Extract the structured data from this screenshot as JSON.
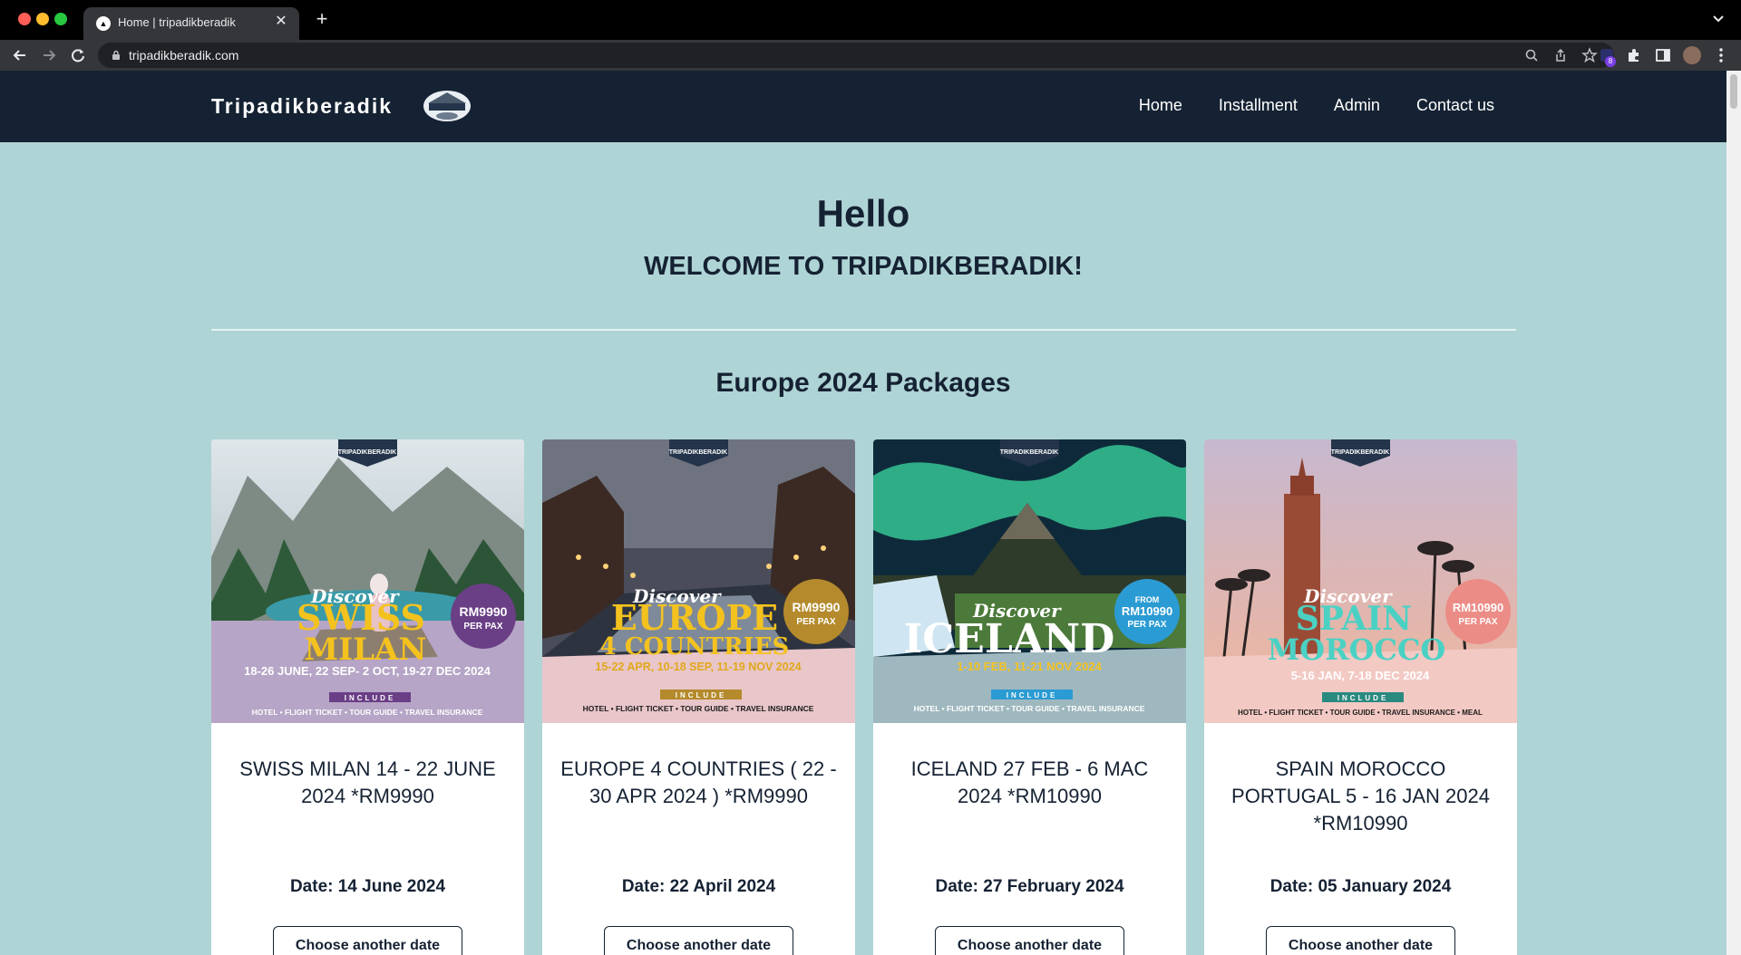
{
  "browser": {
    "tab_title": "Home | tripadikberadik",
    "tab_close": "✕",
    "new_tab": "+",
    "url": "tripadikberadik.com",
    "extension_badge": "8"
  },
  "site": {
    "brand": "Tripadikberadik",
    "nav": [
      "Home",
      "Installment",
      "Admin",
      "Contact us"
    ]
  },
  "hero": {
    "title": "Hello",
    "subtitle": "WELCOME TO TRIPADIKBERADIK!"
  },
  "section_title": "Europe 2024 Packages",
  "packages": [
    {
      "title": "SWISS MILAN 14 - 22 JUNE 2024 *RM9990",
      "date": "Date: 14 June 2024",
      "button": "Choose another date",
      "poster": {
        "script": "Discover",
        "headline1": "SWISS",
        "headline2": "MILAN",
        "price": "RM9990",
        "per": "PER PAX",
        "dates": "18-26 JUNE, 22 SEP- 2 OCT, 19-27 DEC 2024",
        "include": "INCLUDE",
        "features": "HOTEL • FLIGHT TICKET • TOUR GUIDE • TRAVEL INSURANCE"
      }
    },
    {
      "title": "EUROPE 4 COUNTRIES ( 22 - 30 APR 2024 ) *RM9990",
      "date": "Date: 22 April 2024",
      "button": "Choose another date",
      "poster": {
        "script": "Discover",
        "headline1": "EUROPE",
        "headline2": "4 COUNTRIES",
        "price": "RM9990",
        "per": "PER PAX",
        "dates": "15-22 APR, 10-18 SEP, 11-19 NOV 2024",
        "include": "INCLUDE",
        "features": "HOTEL • FLIGHT TICKET • TOUR GUIDE • TRAVEL INSURANCE"
      }
    },
    {
      "title": "ICELAND 27 FEB - 6 MAC 2024 *RM10990",
      "date": "Date: 27 February 2024",
      "button": "Choose another date",
      "poster": {
        "script": "Discover",
        "headline1": "ICELAND",
        "headline2": "",
        "from": "FROM",
        "price": "RM10990",
        "per": "PER PAX",
        "dates": "1-10 FEB, 11-21 NOV 2024",
        "include": "INCLUDE",
        "features": "HOTEL • FLIGHT TICKET • TOUR GUIDE • TRAVEL INSURANCE"
      }
    },
    {
      "title": "SPAIN MOROCCO PORTUGAL 5 - 16 JAN 2024 *RM10990",
      "date": "Date: 05 January 2024",
      "button": "Choose another date",
      "poster": {
        "script": "Discover",
        "headline1": "SPAIN",
        "headline2": "MOROCCO",
        "price": "RM10990",
        "per": "PER PAX",
        "dates": "5-16 JAN, 7-18 DEC 2024",
        "include": "INCLUDE",
        "features": "HOTEL • FLIGHT TICKET • TOUR GUIDE • TRAVEL INSURANCE • MEAL"
      }
    }
  ]
}
